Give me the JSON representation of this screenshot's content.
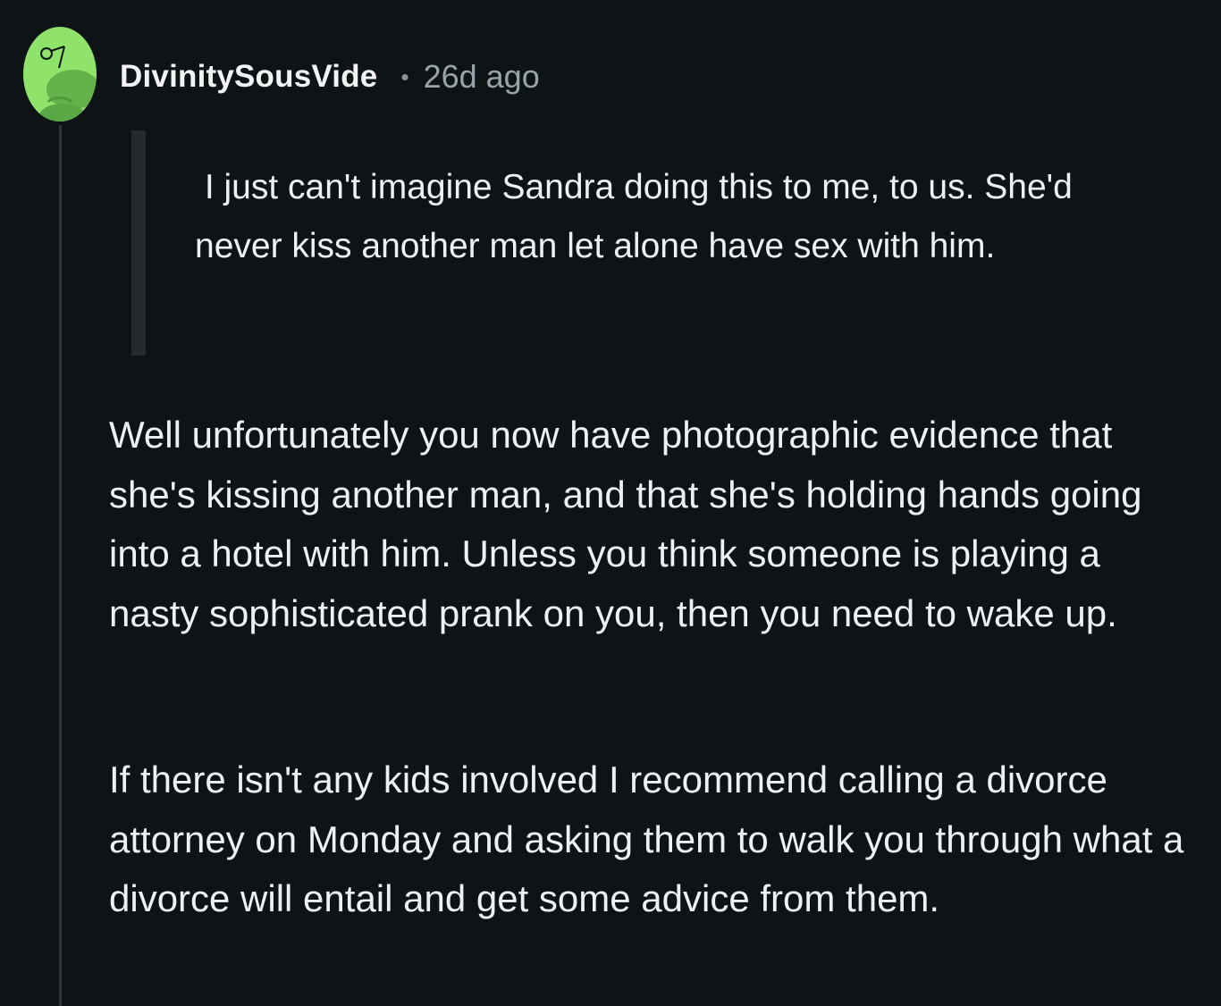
{
  "comment": {
    "author": "DivinitySousVide",
    "separator": "•",
    "timestamp": "26d ago",
    "avatar_icon": "snoo-avatar-icon",
    "accent_color": "#8fe36a",
    "quote": " I just can't imagine Sandra doing this to me, to us. She'd never kiss another man let alone have sex with him.",
    "paragraphs": [
      "Well unfortunately you now have photographic evidence that she's kissing another man, and that she's holding hands going into a hotel with him. Unless you think someone is playing a nasty sophisticated prank on you, then you need to wake up.",
      "If there isn't any kids involved I recommend calling a divorce attorney on Monday and asking them to walk you through what a divorce will entail and get some advice from them."
    ]
  }
}
